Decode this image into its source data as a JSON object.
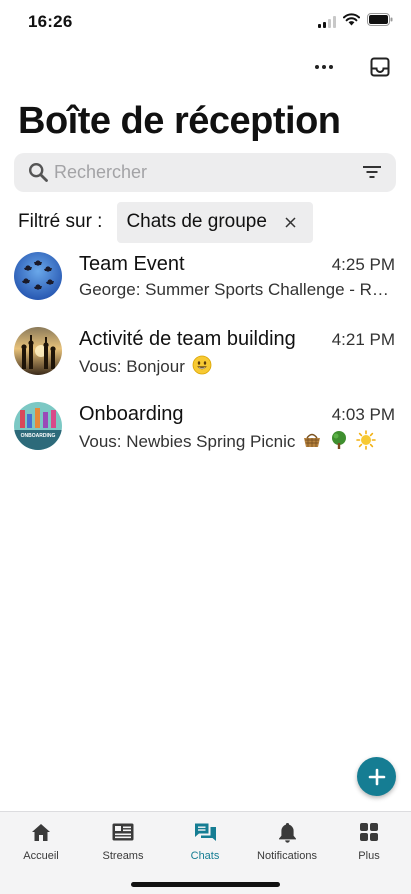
{
  "status_bar": {
    "time": "16:26"
  },
  "header": {
    "title": "Boîte de réception"
  },
  "search": {
    "placeholder": "Rechercher"
  },
  "filter": {
    "label": "Filtré sur :",
    "chip_label": "Chats de groupe"
  },
  "chats": [
    {
      "name": "Team Event",
      "time": "4:25 PM",
      "preview": "George: Summer Sports Challenge - Reminder"
    },
    {
      "name": "Activité de team building",
      "time": "4:21 PM",
      "preview": "Vous: Bonjour"
    },
    {
      "name": "Onboarding",
      "time": "4:03 PM",
      "preview": "Vous: Newbies Spring Picnic"
    }
  ],
  "tabs": [
    {
      "label": "Accueil",
      "icon": "home-icon"
    },
    {
      "label": "Streams",
      "icon": "streams-icon"
    },
    {
      "label": "Chats",
      "icon": "chats-icon",
      "active": true
    },
    {
      "label": "Notifications",
      "icon": "bell-icon"
    },
    {
      "label": "Plus",
      "icon": "grid-icon"
    }
  ],
  "colors": {
    "accent": "#157d93",
    "surface": "#ededee",
    "tab_bar": "#f4f4f5"
  }
}
